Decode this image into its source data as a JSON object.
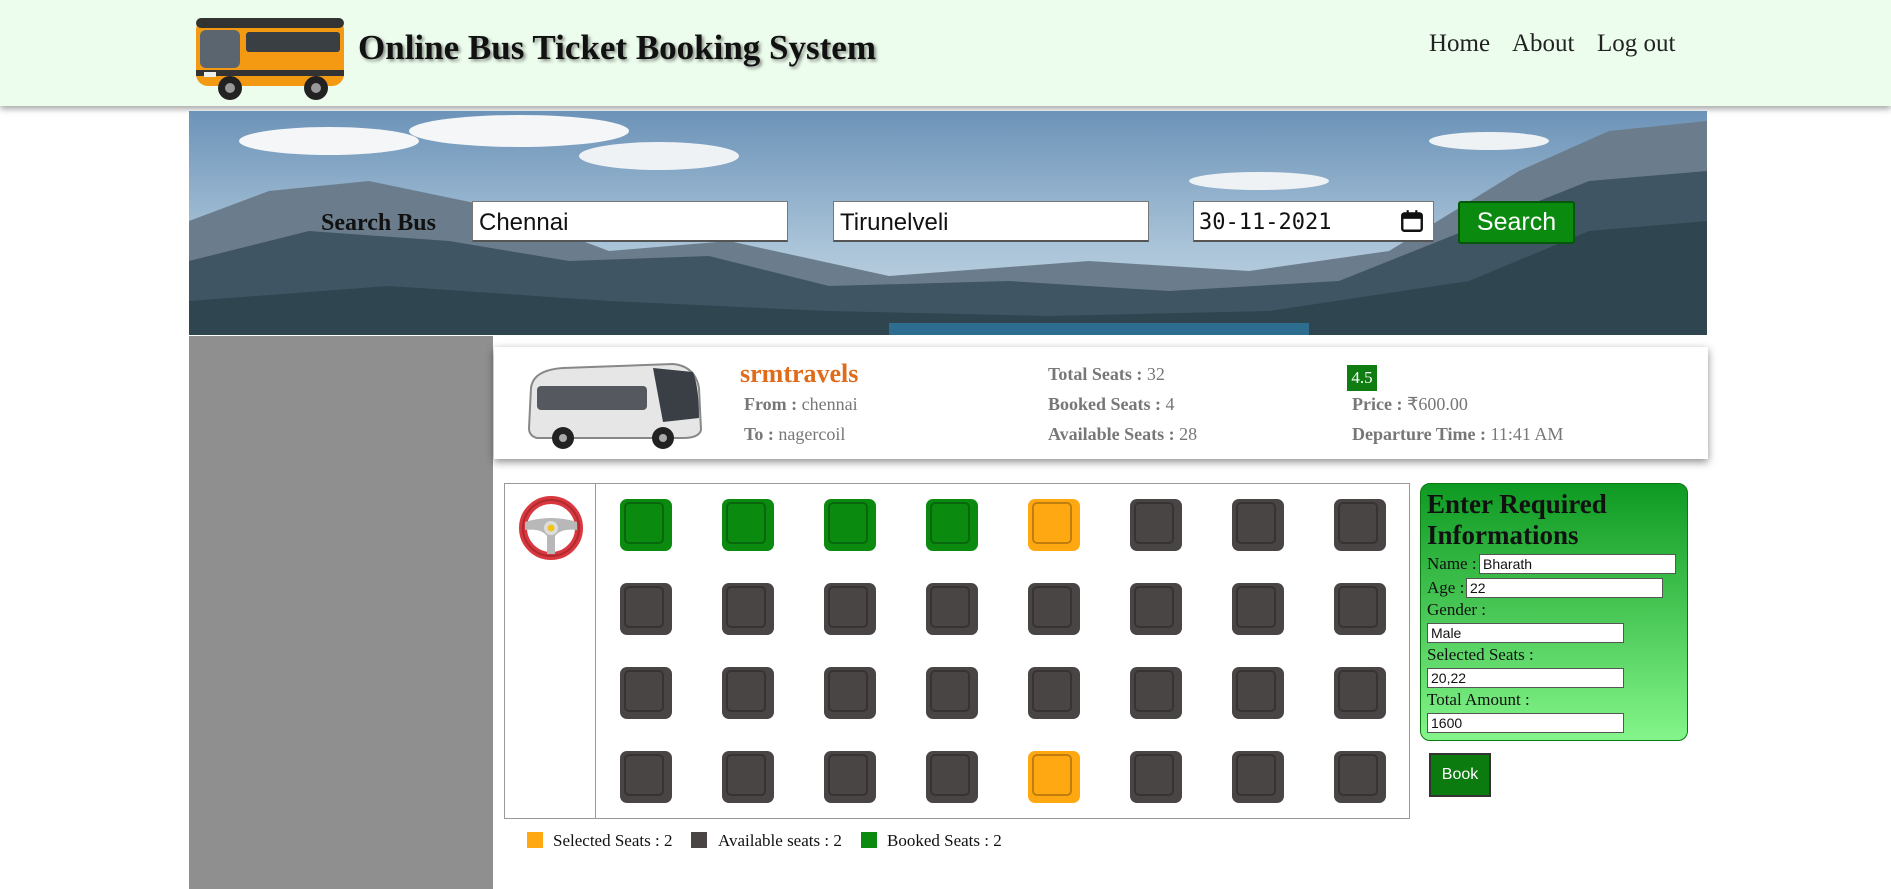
{
  "header": {
    "title": "Online Bus Ticket Booking System",
    "nav": [
      "Home",
      "About",
      "Log out"
    ]
  },
  "search": {
    "label": "Search Bus",
    "from_value": "Chennai",
    "to_value": "Tirunelveli",
    "date_value": "30-11-2021",
    "button_label": "Search"
  },
  "bus": {
    "operator": "srmtravels",
    "from_label": "From :",
    "from_value": "chennai",
    "to_label": "To :",
    "to_value": "nagercoil",
    "total_label": "Total Seats :",
    "total_value": "32",
    "booked_label": "Booked Seats :",
    "booked_value": "4",
    "available_label": "Available Seats :",
    "available_value": "28",
    "rating": "4.5",
    "price_label": "Price :",
    "price_value": "₹600.00",
    "departure_label": "Departure Time :",
    "departure_value": "11:41 AM"
  },
  "seats": {
    "colors": {
      "booked": "#0b8a10",
      "selected": "#ffa812",
      "available": "#4a4545"
    },
    "rows": [
      [
        "booked",
        "booked",
        "booked",
        "booked",
        "selected",
        "available",
        "available",
        "available"
      ],
      [
        "available",
        "available",
        "available",
        "available",
        "available",
        "available",
        "available",
        "available"
      ],
      [
        "available",
        "available",
        "available",
        "available",
        "available",
        "available",
        "available",
        "available"
      ],
      [
        "available",
        "available",
        "available",
        "available",
        "selected",
        "available",
        "available",
        "available"
      ]
    ]
  },
  "form": {
    "title": "Enter Required Informations",
    "name_label": "Name :",
    "name_value": "Bharath",
    "age_label": "Age :",
    "age_value": "22",
    "gender_label": "Gender :",
    "gender_value": "Male",
    "seats_label": "Selected Seats :",
    "seats_value": "20,22",
    "amount_label": "Total Amount :",
    "amount_value": "1600",
    "book_label": "Book"
  },
  "legend": {
    "selected": "Selected Seats : 2",
    "available": "Available seats : 2",
    "booked": "Booked Seats : 2"
  }
}
